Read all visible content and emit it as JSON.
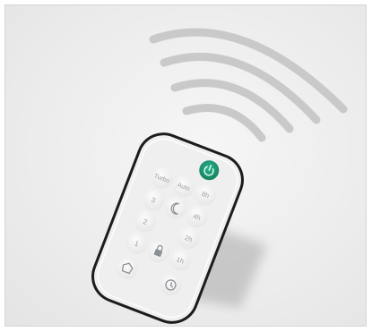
{
  "remote": {
    "buttons": [
      {
        "id": "turbo",
        "label": "Turbo"
      },
      {
        "id": "auto",
        "label": "Auto"
      },
      {
        "id": "8h",
        "label": "8h"
      },
      {
        "id": "3",
        "label": "3"
      },
      {
        "id": "4h",
        "label": "4h"
      },
      {
        "id": "2",
        "label": "2"
      },
      {
        "id": "2h",
        "label": "2h"
      },
      {
        "id": "1",
        "label": "1"
      },
      {
        "id": "1h",
        "label": "1h"
      }
    ],
    "icons": {
      "power": "power-icon",
      "sleep": "moon-icon",
      "lock": "lock-icon",
      "home": "home-icon",
      "timer": "clock-icon"
    },
    "colors": {
      "power_button": "#1f9e7a",
      "body": "#eeeeee",
      "bezel": "#1c1c1c",
      "signal_waves": "#c8c8c8"
    }
  }
}
